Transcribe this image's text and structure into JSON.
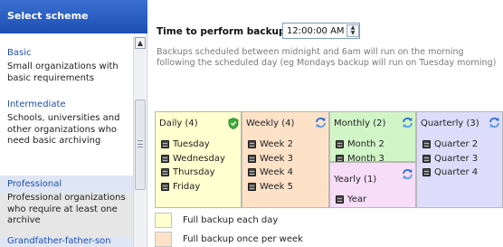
{
  "sidebar": {
    "header": "Select scheme",
    "schemes": [
      {
        "name": "Basic",
        "description": "Small organizations with basic requirements"
      },
      {
        "name": "Intermediate",
        "description": "Schools, universities and other organizations who need basic archiving"
      },
      {
        "name": "Professional",
        "description": "Professional organizations who require at least one archive"
      },
      {
        "name": "Grandfather-father-son",
        "description": ""
      }
    ],
    "selected": "Professional"
  },
  "backup": {
    "time_label": "Time to perform backup:",
    "time_value": "12:00:00 AM",
    "note": "Backups scheduled between midnight and 6am will run on the morning following the scheduled day (eg Mondays backup will run on Tuesday morning)"
  },
  "calendar": {
    "daily": {
      "title": "Daily (4)",
      "items": [
        "Tuesday",
        "Wednesday",
        "Thursday",
        "Friday"
      ],
      "color": "#ffffcf"
    },
    "weekly": {
      "title": "Weekly (4)",
      "items": [
        "Week 2",
        "Week 3",
        "Week 4",
        "Week 5"
      ],
      "color": "#fde2c8"
    },
    "monthly": {
      "title": "Monthly (2)",
      "items": [
        "Month 2",
        "Month 3"
      ],
      "color": "#d2f5c8"
    },
    "yearly": {
      "title": "Yearly (1)",
      "items": [
        "Year"
      ],
      "color": "#f7ddf8"
    },
    "quarterly": {
      "title": "Quarterly (3)",
      "items": [
        "Quarter 2",
        "Quarter 3",
        "Quarter 4"
      ],
      "color": "#ddddfb"
    }
  },
  "legend": [
    {
      "label": "Full backup each day",
      "color": "#ffffcf"
    },
    {
      "label": "Full backup once per week",
      "color": "#fde2c8"
    }
  ],
  "icons": {
    "daily": "shield-icon",
    "weekly": "sync-icon",
    "monthly": "sync-icon",
    "yearly": "sync-icon",
    "quarterly": "sync-icon",
    "items": "calendar-icon"
  },
  "colors": {
    "accent": "#1d4fb3",
    "link": "#1f4fae",
    "selected_bg": "#dfe6f5",
    "note_text": "#7a7a7a"
  }
}
